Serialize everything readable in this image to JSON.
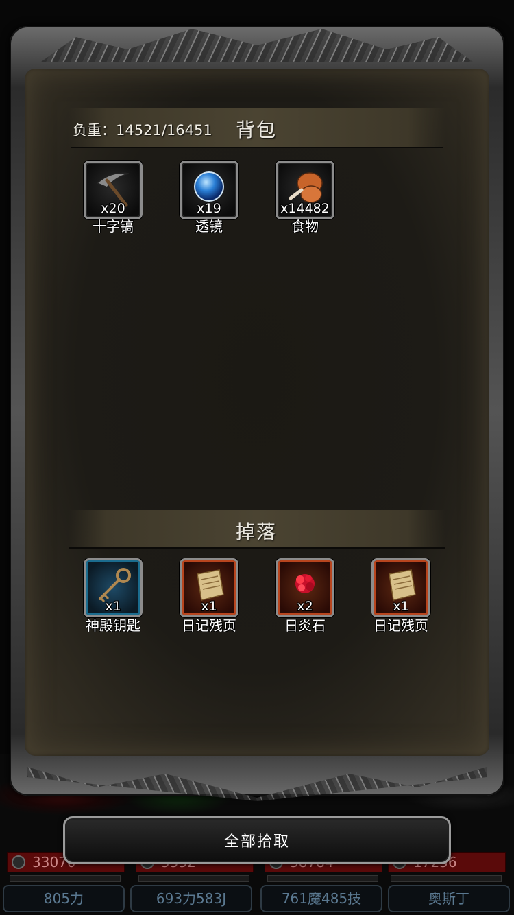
{
  "backpack": {
    "title": "背包",
    "weight_label": "负重：14521/16451",
    "items": [
      {
        "name": "十字镐",
        "count": "x20",
        "icon": "pickaxe-icon"
      },
      {
        "name": "透镜",
        "count": "x19",
        "icon": "blue-lens-icon"
      },
      {
        "name": "食物",
        "count": "x14482",
        "icon": "meat-drumstick-icon"
      }
    ]
  },
  "drops": {
    "title": "掉落",
    "items": [
      {
        "name": "神殿钥匙",
        "count": "x1",
        "icon": "key-icon",
        "rarity_color": "#1b6c8e"
      },
      {
        "name": "日记残页",
        "count": "x1",
        "icon": "parchment-icon",
        "rarity_color": "#b8451e"
      },
      {
        "name": "日炎石",
        "count": "x2",
        "icon": "red-ore-icon",
        "rarity_color": "#b8451e"
      },
      {
        "name": "日记残页",
        "count": "x1",
        "icon": "parchment-icon",
        "rarity_color": "#b8451e"
      }
    ]
  },
  "pickup_all_label": "全部拾取",
  "party": [
    {
      "hp": "33070",
      "name": "805力"
    },
    {
      "hp": "5532",
      "name": "693力583J"
    },
    {
      "hp": "38784",
      "name": "761魔485技"
    },
    {
      "hp": "17256",
      "name": "奥斯丁"
    }
  ]
}
